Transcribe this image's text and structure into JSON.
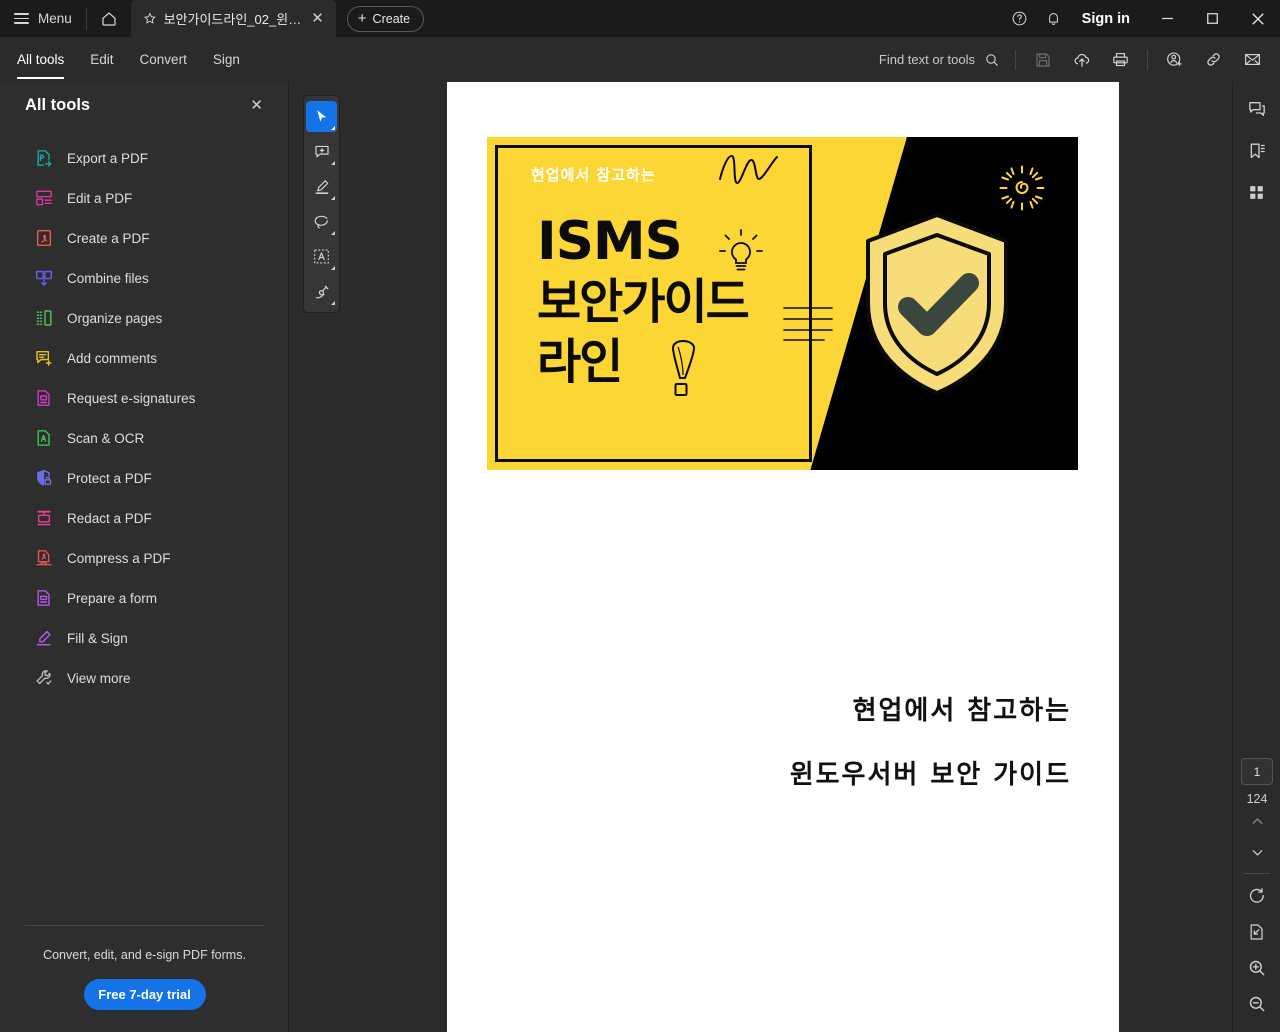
{
  "titlebar": {
    "menu_label": "Menu",
    "home_icon": "home-icon",
    "tab": {
      "title": "보안가이드라인_02_윈도…",
      "star_icon": "star-icon",
      "close_icon": "close-icon"
    },
    "create_label": "Create",
    "help_icon": "help-circle-icon",
    "bell_icon": "bell-icon",
    "signin_label": "Sign in",
    "minimize_icon": "minimize-icon",
    "maximize_icon": "maximize-icon",
    "close_icon": "window-close-icon"
  },
  "menubar": {
    "tabs": [
      {
        "label": "All tools",
        "active": true
      },
      {
        "label": "Edit",
        "active": false
      },
      {
        "label": "Convert",
        "active": false
      },
      {
        "label": "Sign",
        "active": false
      }
    ],
    "find_placeholder": "Find text or tools",
    "search_icon": "search-icon",
    "actions": [
      {
        "name": "save-icon",
        "disabled": true
      },
      {
        "name": "upload-cloud-icon",
        "disabled": false
      },
      {
        "name": "print-icon",
        "disabled": false
      },
      {
        "name": "add-person-icon",
        "disabled": false
      },
      {
        "name": "link-icon",
        "disabled": false
      },
      {
        "name": "email-icon",
        "disabled": false
      }
    ]
  },
  "left_panel": {
    "title": "All tools",
    "close_icon": "close-icon",
    "tools": [
      {
        "label": "Export a PDF",
        "icon": "export-pdf-icon",
        "color": "#1aa8a0"
      },
      {
        "label": "Edit a PDF",
        "icon": "edit-pdf-icon",
        "color": "#e0379c"
      },
      {
        "label": "Create a PDF",
        "icon": "create-pdf-icon",
        "color": "#e8584f"
      },
      {
        "label": "Combine files",
        "icon": "combine-files-icon",
        "color": "#6a5bef"
      },
      {
        "label": "Organize pages",
        "icon": "organize-pages-icon",
        "color": "#55c257"
      },
      {
        "label": "Add comments",
        "icon": "add-comments-icon",
        "color": "#e8c31c"
      },
      {
        "label": "Request e-signatures",
        "icon": "request-esign-icon",
        "color": "#d336c7"
      },
      {
        "label": "Scan & OCR",
        "icon": "scan-ocr-icon",
        "color": "#3fbf52"
      },
      {
        "label": "Protect a PDF",
        "icon": "protect-pdf-icon",
        "color": "#6a6ce8"
      },
      {
        "label": "Redact a PDF",
        "icon": "redact-pdf-icon",
        "color": "#e8409a"
      },
      {
        "label": "Compress a PDF",
        "icon": "compress-pdf-icon",
        "color": "#e0554c"
      },
      {
        "label": "Prepare a form",
        "icon": "prepare-form-icon",
        "color": "#b755e8"
      },
      {
        "label": "Fill & Sign",
        "icon": "fill-sign-icon",
        "color": "#b25ef0"
      },
      {
        "label": "View more",
        "icon": "view-more-icon",
        "color": "#b8b8b8"
      }
    ],
    "promo_text": "Convert, edit, and e-sign PDF forms.",
    "trial_label": "Free 7-day trial",
    "trial_color": "#1473e6"
  },
  "quickbar": {
    "tools": [
      {
        "name": "select-tool",
        "active": true
      },
      {
        "name": "add-comment-tool",
        "active": false
      },
      {
        "name": "highlight-tool",
        "active": false
      },
      {
        "name": "lasso-draw-tool",
        "active": false
      },
      {
        "name": "select-text-tool",
        "active": false
      },
      {
        "name": "ink-eraser-tool",
        "active": false
      }
    ]
  },
  "document": {
    "cover": {
      "kicker": "현업에서 참고하는",
      "title_en": "ISMS",
      "title_line2": "보안가이드",
      "title_line3": "라인",
      "yellow": "#FCD634",
      "black": "#000000",
      "shield_fill": "#F7DD7A",
      "check_color": "#3A463E"
    },
    "body_lines": [
      "현업에서  참고하는",
      "윈도우서버  보안  가이드"
    ]
  },
  "right_rail": {
    "top_buttons": [
      {
        "name": "comments-panel-icon"
      },
      {
        "name": "bookmarks-panel-icon"
      },
      {
        "name": "page-thumbnails-icon"
      }
    ],
    "current_page": "1",
    "total_pages": "124",
    "prev_icon": "chevron-up-icon",
    "next_icon": "chevron-down-icon",
    "rotate_icon": "rotate-cw-icon",
    "fit_page_icon": "fit-page-icon",
    "zoom_in_icon": "zoom-in-icon",
    "zoom_out_icon": "zoom-out-icon"
  }
}
